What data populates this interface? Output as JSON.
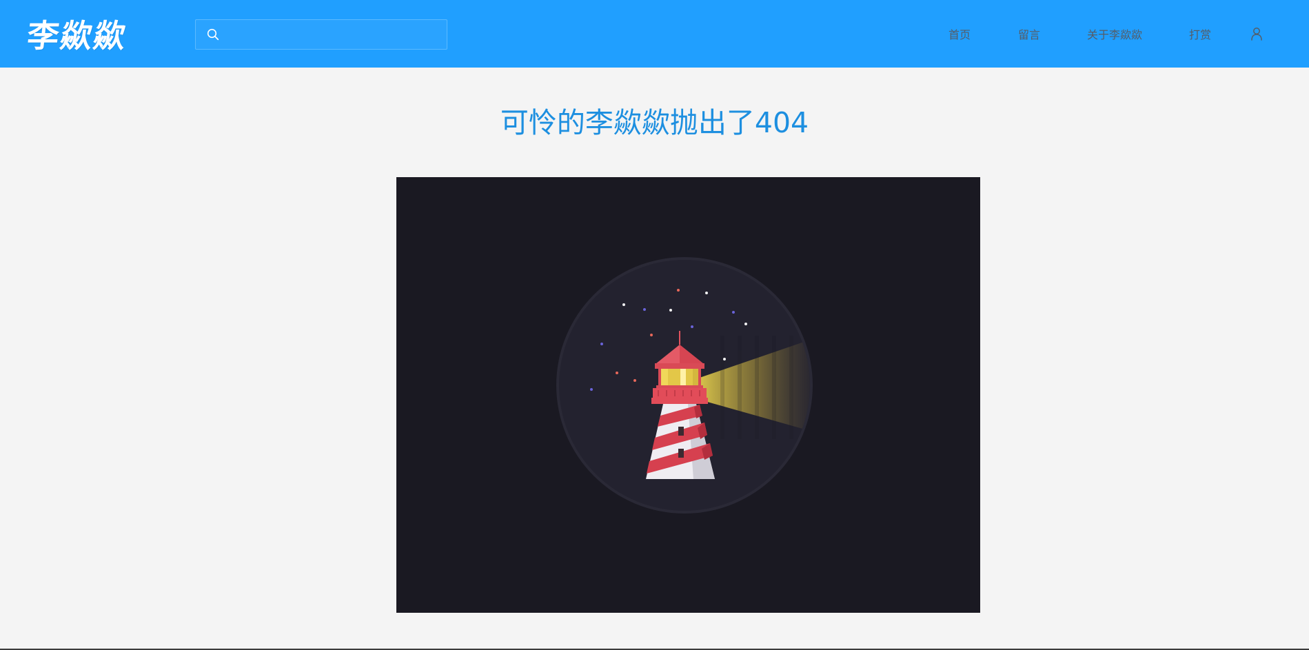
{
  "header": {
    "logo_text": "李歘歘",
    "search": {
      "placeholder": "",
      "value": "",
      "icon": "search-icon"
    },
    "nav": {
      "home": "首页",
      "message": "留言",
      "about": "关于李歘歘",
      "reward": "打赏",
      "user_icon": "user-icon"
    },
    "colors": {
      "bar": "#209fff",
      "nav_text": "#555c66"
    }
  },
  "main": {
    "title": "可怜的李歘歘抛出了404",
    "title_color": "#1d8fe0",
    "illustration": {
      "subject": "lighthouse-at-night",
      "background": "#1a1922",
      "circle": "#23222f",
      "beam": "#e5cf4d",
      "tower_red": "#e0404f",
      "tower_white": "#f0eef2"
    }
  },
  "page": {
    "background": "#f4f4f4"
  }
}
